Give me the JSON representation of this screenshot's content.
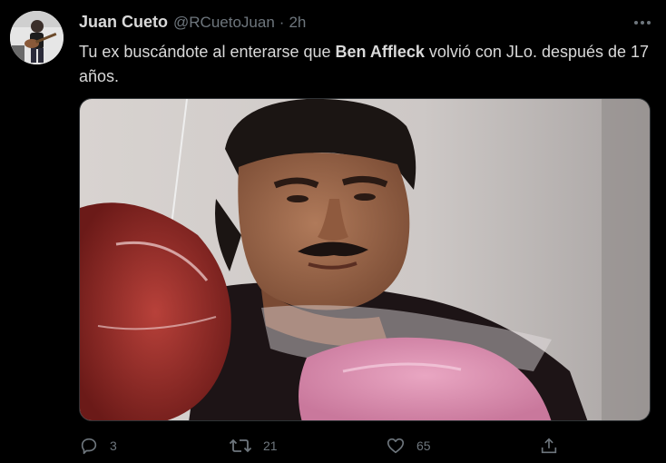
{
  "tweet": {
    "author_name": "Juan Cueto",
    "handle": "@RCuetoJuan",
    "separator": "·",
    "time": "2h",
    "text_before": "Tu ex buscándote al enterarse que ",
    "text_bold": "Ben Affleck",
    "text_after": " volvió con JLo. después de 17 años.",
    "avatar_icon": "profile-photo-guitarist",
    "media_description": "meme-image"
  },
  "actions": {
    "reply_icon": "reply-icon",
    "reply_count": "3",
    "retweet_icon": "retweet-icon",
    "retweet_count": "21",
    "like_icon": "heart-icon",
    "like_count": "65",
    "share_icon": "share-icon"
  },
  "colors": {
    "background": "#000000",
    "text": "#d9d9d9",
    "secondary": "#6e767d",
    "border": "#2f3336"
  }
}
